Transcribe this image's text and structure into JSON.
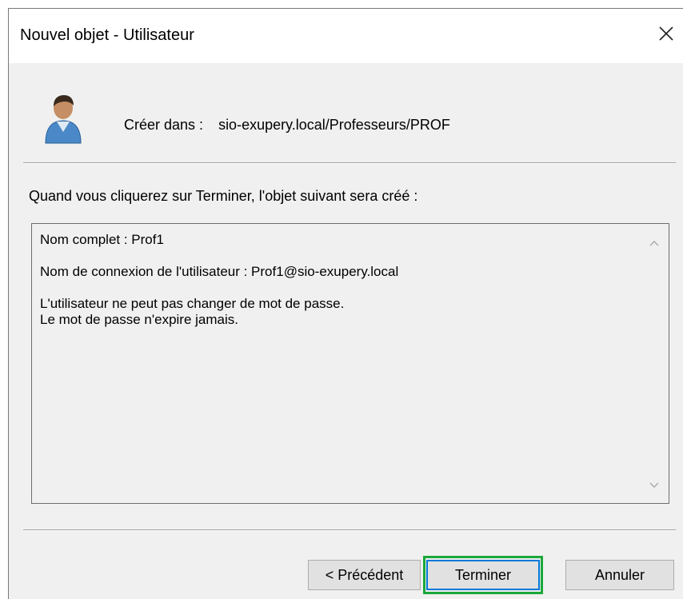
{
  "window": {
    "title": "Nouvel objet - Utilisateur",
    "close_icon": "close-icon"
  },
  "header": {
    "icon": "user-icon",
    "create_in_label": "Créer dans :",
    "create_in_path": "sio-exupery.local/Professeurs/PROF"
  },
  "intro_text": "Quand vous cliquerez sur Terminer, l'objet suivant sera créé :",
  "summary": {
    "full_name": "Nom complet : Prof1",
    "logon_name": "Nom de connexion de l'utilisateur : Prof1@sio-exupery.local",
    "password_change": "L'utilisateur ne peut pas changer de mot de passe.",
    "password_expiry": "Le mot de passe n'expire jamais."
  },
  "buttons": {
    "previous": "< Précédent",
    "finish": "Terminer",
    "cancel": "Annuler"
  },
  "colors": {
    "highlight": "#1aa83a",
    "default_button_border": "#0078d7",
    "dialog_bg": "#f0f0f0"
  }
}
